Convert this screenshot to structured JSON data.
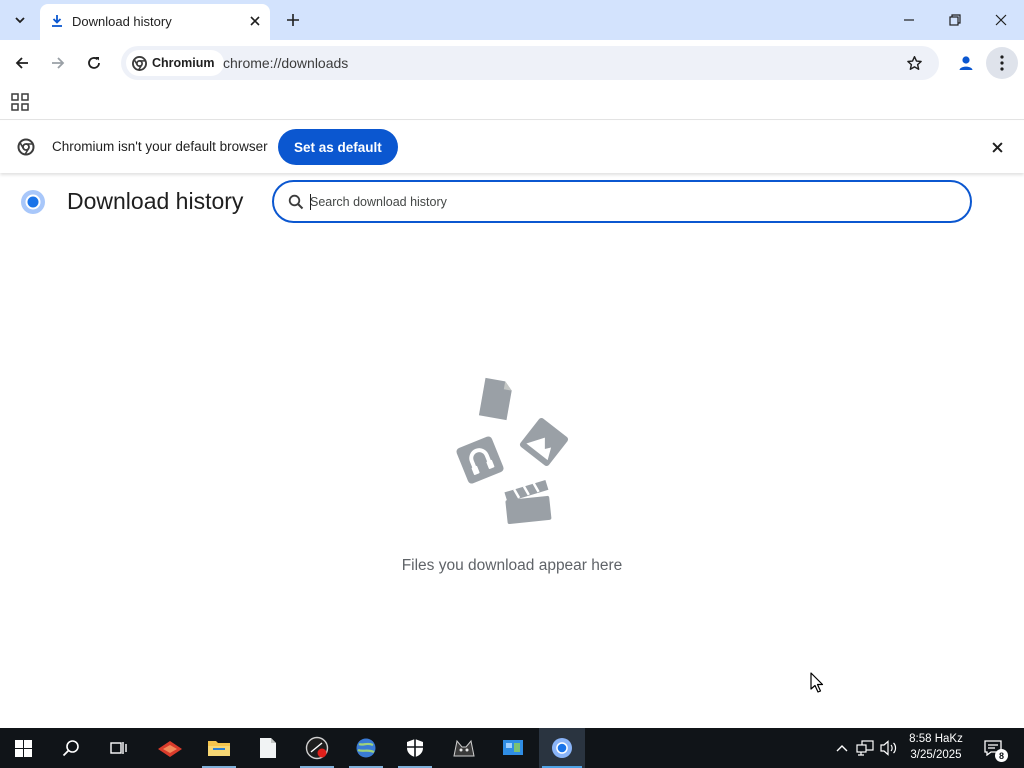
{
  "window": {
    "tab": {
      "title": "Download history",
      "favicon": "download-icon"
    },
    "controls": [
      "minimize",
      "restore",
      "close"
    ]
  },
  "toolbar": {
    "site_chip": "Chromium",
    "url": "chrome://downloads",
    "icons": [
      "back-arrow-icon",
      "forward-arrow-icon",
      "reload-icon",
      "star-icon",
      "profile-icon",
      "kebab-menu-icon"
    ]
  },
  "bookmarks_bar": {
    "apps_icon": "apps-grid-icon"
  },
  "infobar": {
    "message": "Chromium isn't your default browser",
    "button": "Set as default"
  },
  "page": {
    "title": "Download history",
    "search_placeholder": "Search download history",
    "empty_message": "Files you download appear here"
  },
  "taskbar": {
    "clock_time": "8:58 HaKz",
    "clock_date": "3/25/2025",
    "notification_count": "8",
    "apps": [
      "start",
      "search",
      "task-view",
      "app-red",
      "file-explorer",
      "notepad",
      "app-dark-red",
      "network-globe",
      "shield",
      "cat-app",
      "control-panel",
      "chromium"
    ],
    "colors": {
      "taskbar_bg": "#101418",
      "accent": "#0b57d0",
      "tab_strip": "#d3e3fd"
    }
  }
}
